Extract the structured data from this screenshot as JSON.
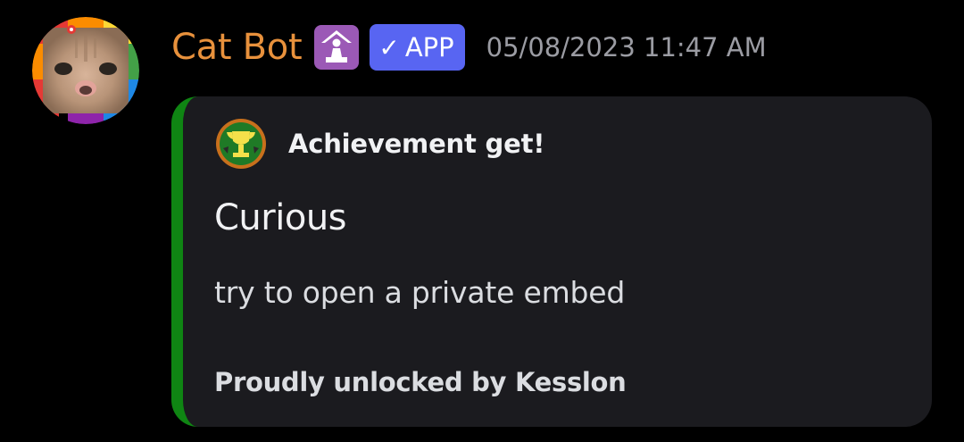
{
  "message": {
    "author": {
      "username": "Cat Bot",
      "username_color": "#e8913c",
      "avatar_icon": "cat-avatar-icon",
      "role_icon": "prayer-role-icon",
      "badge": {
        "check": "✓",
        "label": "APP",
        "color": "#5865f2"
      }
    },
    "timestamp": "05/08/2023 11:47 AM"
  },
  "embed": {
    "accent_color": "#0f8513",
    "author_icon": "trophy-icon",
    "author_name": "Achievement get!",
    "title": "Curious",
    "description": "try to open a private embed",
    "footer": "Proudly unlocked by Kesslon"
  }
}
